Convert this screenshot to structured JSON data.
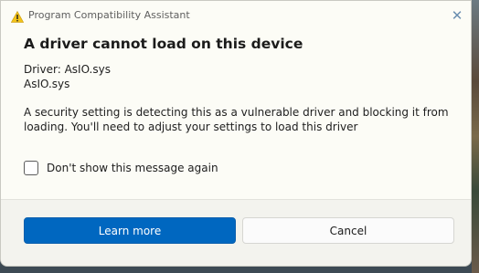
{
  "window": {
    "title": "Program Compatibility Assistant",
    "title_icon": "warning-icon",
    "close_icon": "close-icon",
    "close_glyph": "✕"
  },
  "content": {
    "heading": "A driver cannot load on this device",
    "driver_label": "Driver: AsIO.sys",
    "driver_file": "AsIO.sys",
    "message": "A security setting is detecting this as a vulnerable driver and blocking it from loading. You'll need to adjust your settings to load this driver"
  },
  "checkbox": {
    "label": "Don't show this message again",
    "checked": false
  },
  "buttons": {
    "primary_label": "Learn more",
    "secondary_label": "Cancel"
  },
  "colors": {
    "accent": "#0067c0",
    "warning": "#f2c318",
    "dialog_bg": "#fcfcf6",
    "footer_bg": "#f3f3ee"
  }
}
